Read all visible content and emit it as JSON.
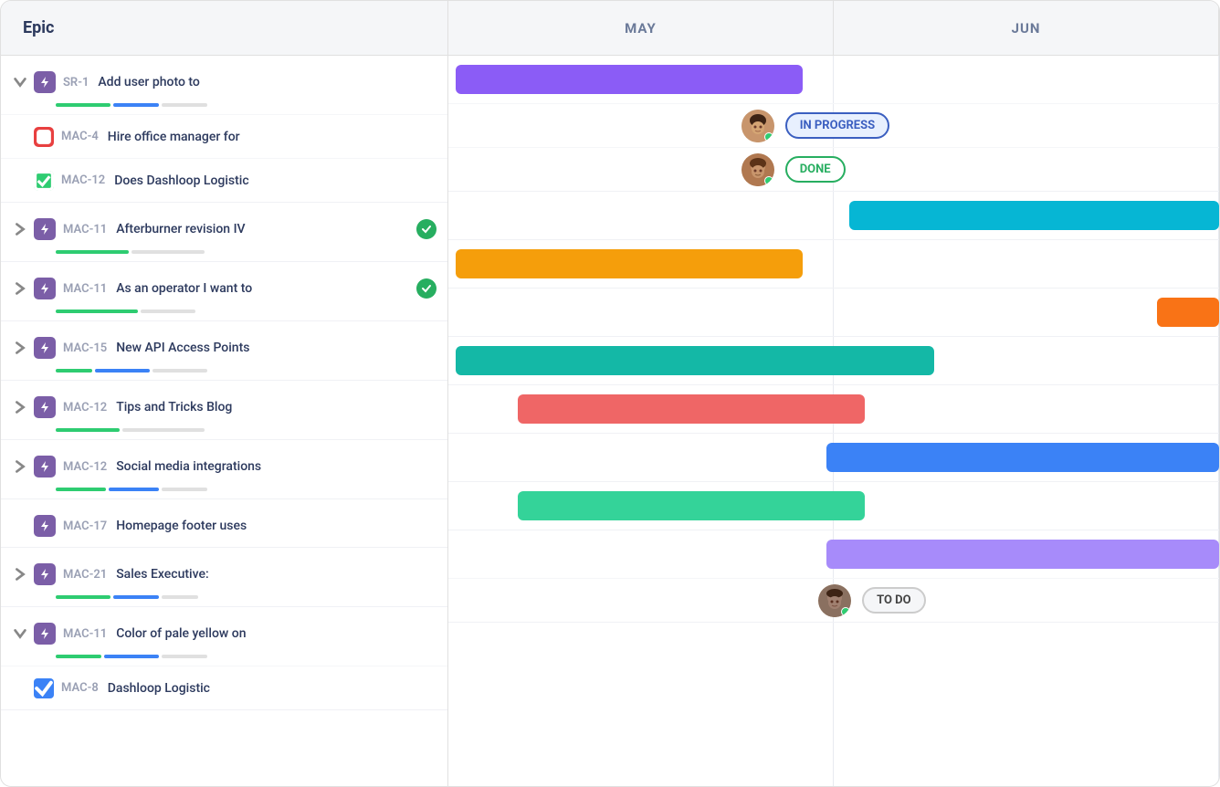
{
  "header": {
    "epic_label": "Epic",
    "months": [
      "MAY",
      "JUN"
    ]
  },
  "rows": [
    {
      "id": "SR-1",
      "title": "Add user photo to",
      "icon_type": "purple",
      "expandable": true,
      "expanded": true,
      "progress": [
        {
          "color": "#2ecc71",
          "width": 60
        },
        {
          "color": "#3b82f6",
          "width": 50
        },
        {
          "color": "#e0e0e0",
          "width": 50
        }
      ],
      "bar": {
        "color": "bar-purple",
        "left_pct": 1,
        "width_pct": 45
      },
      "sub_rows": [
        {
          "id": "MAC-4",
          "title": "Hire office manager for",
          "icon_type": "red-sq",
          "status": "IN PROGRESS",
          "avatar": "1"
        },
        {
          "id": "MAC-12",
          "title": "Does Dashloop Logistic",
          "icon_type": "green-sq",
          "status": "DONE",
          "avatar": "2"
        }
      ]
    },
    {
      "id": "MAC-11",
      "title": "Afterburner revision IV",
      "icon_type": "purple",
      "expandable": true,
      "expanded": false,
      "check": true,
      "progress": [
        {
          "color": "#2ecc71",
          "width": 80
        },
        {
          "color": "#e0e0e0",
          "width": 80
        }
      ],
      "bar": {
        "color": "bar-cyan",
        "left_pct": 52,
        "width_pct": 48
      }
    },
    {
      "id": "MAC-11",
      "title": "As an operator I want to",
      "icon_type": "purple",
      "expandable": true,
      "expanded": false,
      "check": true,
      "progress": [
        {
          "color": "#2ecc71",
          "width": 90
        },
        {
          "color": "#e0e0e0",
          "width": 60
        }
      ],
      "bar": {
        "color": "bar-yellow",
        "left_pct": 1,
        "width_pct": 45
      }
    },
    {
      "id": "MAC-15",
      "title": "New API Access Points",
      "icon_type": "purple",
      "expandable": true,
      "expanded": false,
      "progress": [
        {
          "color": "#2ecc71",
          "width": 40
        },
        {
          "color": "#3b82f6",
          "width": 60
        },
        {
          "color": "#e0e0e0",
          "width": 60
        }
      ],
      "bar": {
        "color": "bar-orange",
        "left_pct": 92,
        "width_pct": 8
      }
    },
    {
      "id": "MAC-12",
      "title": "Tips and Tricks Blog",
      "icon_type": "purple",
      "expandable": true,
      "expanded": false,
      "progress": [
        {
          "color": "#2ecc71",
          "width": 70
        },
        {
          "color": "#e0e0e0",
          "width": 90
        }
      ],
      "bar": {
        "color": "bar-teal",
        "left_pct": 1,
        "width_pct": 62
      }
    },
    {
      "id": "MAC-12",
      "title": "Social media integrations",
      "icon_type": "purple",
      "expandable": true,
      "expanded": false,
      "progress": [
        {
          "color": "#2ecc71",
          "width": 55
        },
        {
          "color": "#3b82f6",
          "width": 55
        },
        {
          "color": "#e0e0e0",
          "width": 50
        }
      ],
      "bar": {
        "color": "bar-salmon",
        "left_pct": 9,
        "width_pct": 45
      }
    },
    {
      "id": "MAC-17",
      "title": "Homepage footer uses",
      "icon_type": "purple",
      "expandable": false,
      "expanded": false,
      "progress": [],
      "bar": {
        "color": "bar-blue",
        "left_pct": 49,
        "width_pct": 51
      }
    },
    {
      "id": "MAC-21",
      "title": "Sales Executive:",
      "icon_type": "purple",
      "expandable": true,
      "expanded": false,
      "progress": [
        {
          "color": "#2ecc71",
          "width": 60
        },
        {
          "color": "#3b82f6",
          "width": 50
        },
        {
          "color": "#e0e0e0",
          "width": 40
        }
      ],
      "bar": {
        "color": "bar-green",
        "left_pct": 9,
        "width_pct": 45
      }
    },
    {
      "id": "MAC-11",
      "title": "Color of pale yellow on",
      "icon_type": "purple",
      "expandable": true,
      "expanded": true,
      "progress": [
        {
          "color": "#2ecc71",
          "width": 50
        },
        {
          "color": "#3b82f6",
          "width": 60
        },
        {
          "color": "#e0e0e0",
          "width": 50
        }
      ],
      "bar": {
        "color": "bar-purple-light",
        "left_pct": 49,
        "width_pct": 51
      },
      "sub_rows": [
        {
          "id": "MAC-8",
          "title": "Dashloop Logistic",
          "icon_type": "blue-sq",
          "status": "TO DO",
          "avatar": "3"
        }
      ]
    }
  ]
}
